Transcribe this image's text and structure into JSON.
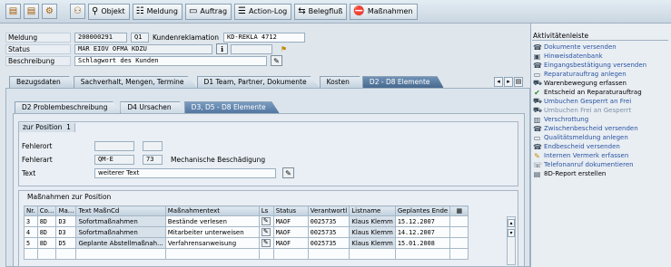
{
  "toolbar": {
    "buttons": [
      {
        "label": "Objekt",
        "icon": "⚲"
      },
      {
        "label": "Meldung",
        "icon": "☷"
      },
      {
        "label": "Auftrag",
        "icon": "▭"
      },
      {
        "label": "Action-Log",
        "icon": "☰"
      },
      {
        "label": "Belegfluß",
        "icon": "⇆"
      },
      {
        "label": "Maßnahmen",
        "icon": "⛔"
      }
    ]
  },
  "header": {
    "meldung_label": "Meldung",
    "meldung_value": "200000291",
    "meldungsart": "Q1",
    "meldungsart_text": "Kundenreklamation",
    "reklamation_value": "KD-REKLA 4712",
    "status_label": "Status",
    "status_value": "MAR EIOV OFMA KDZU",
    "beschreibung_label": "Beschreibung",
    "beschreibung_value": "Schlagwort des Kunden"
  },
  "main_tabs": [
    "Bezugsdaten",
    "Sachverhalt, Mengen, Termine",
    "D1 Team, Partner, Dokumente",
    "Kosten",
    "D2 - D8 Elemente"
  ],
  "sub_tabs": [
    "D2 Problembeschreibung",
    "D4 Ursachen",
    "D3, D5 - D8 Elemente"
  ],
  "position": {
    "title": "zur Position",
    "number": "1",
    "fehlerort_label": "Fehlerort",
    "fehlerart_label": "Fehlerart",
    "fehlerart_code": "QM-E",
    "fehlerart_num": "73",
    "fehlerart_text": "Mechanische Beschädigung",
    "text_label": "Text",
    "text_value": "weiterer Text"
  },
  "measures": {
    "title": "Maßnahmen zur Position",
    "columns": [
      "Nr.",
      "Co...",
      "Ma...",
      "Text MaßnCd",
      "Maßnahmentext",
      "Ls",
      "Status",
      "Verantwortl",
      "Listname",
      "Geplantes Ende"
    ],
    "rows": [
      {
        "nr": "3",
        "co": "8D",
        "ma": "D3",
        "code_text": "Sofortmaßnahmen",
        "text": "Bestände verlesen",
        "status": "MAOF",
        "verantw": "0025735",
        "listname": "Klaus Klemm",
        "ende": "15.12.2007"
      },
      {
        "nr": "4",
        "co": "8D",
        "ma": "D3",
        "code_text": "Sofortmaßnahmen",
        "text": "Mitarbeiter unterweisen",
        "status": "MAOF",
        "verantw": "0025735",
        "listname": "Klaus Klemm",
        "ende": "14.12.2007"
      },
      {
        "nr": "5",
        "co": "8D",
        "ma": "D5",
        "code_text": "Geplante Abstellmaßnah...",
        "text": "Verfahrensanweisung",
        "status": "MAOF",
        "verantw": "0025735",
        "listname": "Klaus Klemm",
        "ende": "15.01.2008"
      }
    ]
  },
  "sidebar": {
    "title": "Aktivitätenleiste",
    "items": [
      {
        "label": "Dokumente versenden",
        "icon": "☎",
        "style": "link"
      },
      {
        "label": "Hinweisdatenbank",
        "icon": "▣",
        "style": "link"
      },
      {
        "label": "Eingangsbestätigung versenden",
        "icon": "☎",
        "style": "link"
      },
      {
        "label": "Reparaturauftrag anlegen",
        "icon": "▭",
        "style": "link"
      },
      {
        "label": "Warenbewegung erfassen",
        "icon": "⛟",
        "style": "black"
      },
      {
        "label": "Entscheid an Reparaturauftrag",
        "icon": "✔",
        "style": "black"
      },
      {
        "label": "Umbuchen Gesperrt an Frei",
        "icon": "⛟",
        "style": "link"
      },
      {
        "label": "Umbuchen Frei an Gesperrt",
        "icon": "⛟",
        "style": "dim"
      },
      {
        "label": "Verschrottung",
        "icon": "▥",
        "style": "link"
      },
      {
        "label": "Zwischenbescheid versenden",
        "icon": "☎",
        "style": "link"
      },
      {
        "label": "Qualitätsmeldung anlegen",
        "icon": "▭",
        "style": "link"
      },
      {
        "label": "Endbescheid versenden",
        "icon": "☎",
        "style": "link"
      },
      {
        "label": "Internen Vermerk erfassen",
        "icon": "✎",
        "style": "link"
      },
      {
        "label": "Telefonanruf dokumentieren",
        "icon": "☏",
        "style": "link"
      },
      {
        "label": "8D-Report erstellen",
        "icon": "▤",
        "style": "black"
      }
    ]
  }
}
